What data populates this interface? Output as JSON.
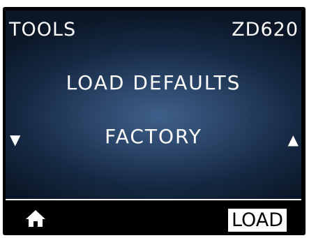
{
  "header": {
    "menu_name": "TOOLS",
    "printer_model": "ZD620"
  },
  "menu": {
    "title": "LOAD DEFAULTS",
    "selected_option": "FACTORY",
    "prev_arrow": "▼",
    "next_arrow": "▲"
  },
  "softkeys": {
    "left_icon": "home-icon",
    "right_label": "LOAD"
  },
  "colors": {
    "background_center": "#3f5f8a",
    "background_edge": "#0b1626",
    "text": "#ffffff",
    "softbar_bg": "#000000"
  }
}
